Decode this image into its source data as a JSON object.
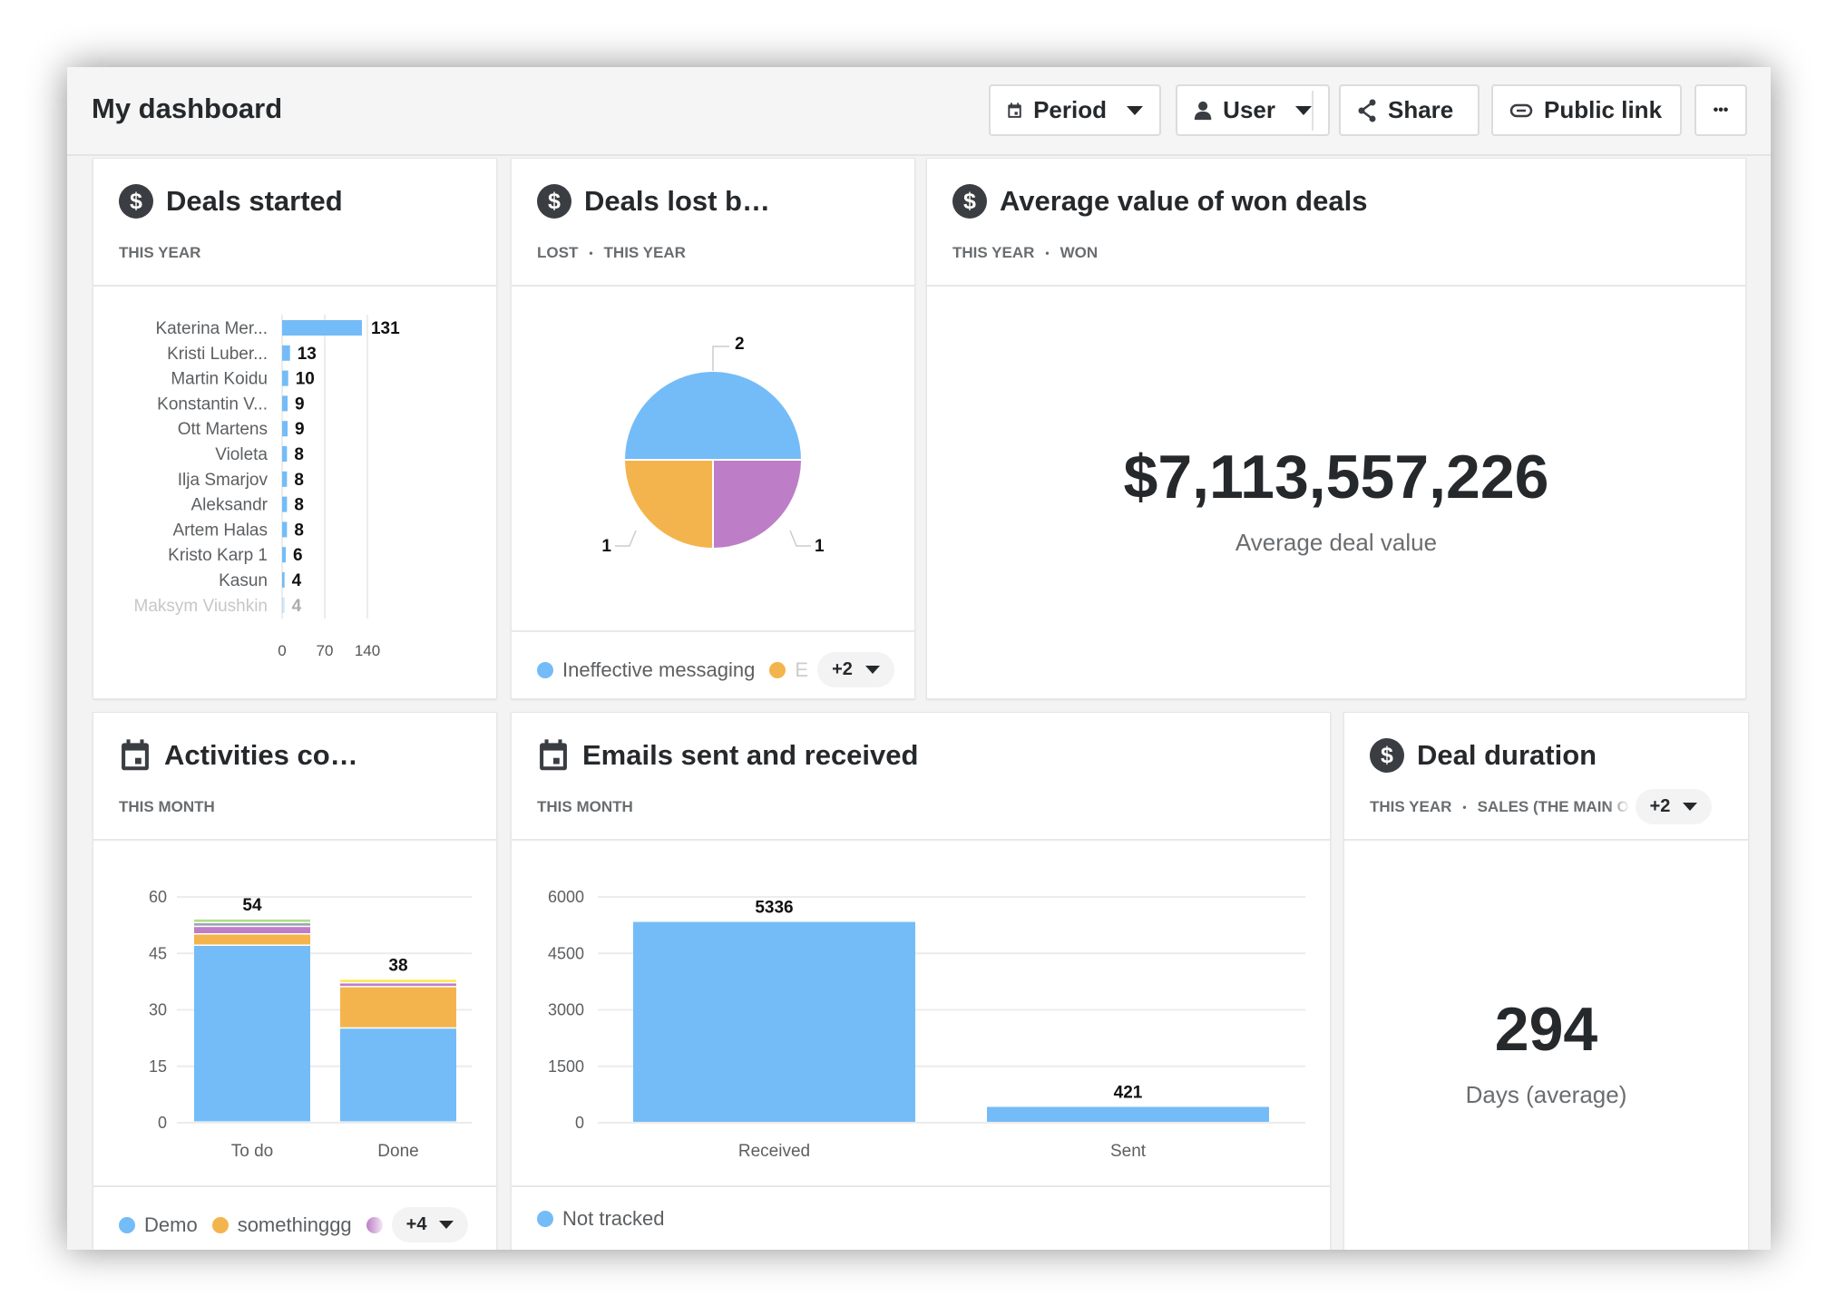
{
  "header": {
    "title": "My dashboard",
    "period_label": "Period",
    "user_label": "User",
    "share_label": "Share",
    "public_link_label": "Public link",
    "more_label": "•••"
  },
  "colors": {
    "blue": "#74bcf7",
    "orange": "#f4b44d",
    "purple": "#bd7dc7",
    "gray": "#9aa7b3",
    "green": "#b0dd8b",
    "yellow": "#fde95a"
  },
  "cards": {
    "deals_started": {
      "title": "Deals started",
      "filters": [
        "THIS YEAR"
      ],
      "icon": "dollar-icon"
    },
    "deals_lost": {
      "title": "Deals lost b…",
      "filters": [
        "LOST",
        "THIS YEAR"
      ],
      "icon": "dollar-icon",
      "legend": [
        {
          "label": "Ineffective messaging",
          "color": "#74bcf7"
        },
        {
          "label": "E",
          "color": "#f4b44d"
        }
      ],
      "more": "+2"
    },
    "avg_value": {
      "title": "Average value of won deals",
      "filters": [
        "THIS YEAR",
        "WON"
      ],
      "icon": "dollar-icon",
      "value": "$7,113,557,226",
      "caption": "Average deal value"
    },
    "activities": {
      "title": "Activities co…",
      "filters": [
        "THIS MONTH"
      ],
      "icon": "calendar-icon",
      "legend": [
        {
          "label": "Demo",
          "color": "#74bcf7"
        },
        {
          "label": "somethinggg",
          "color": "#f4b44d"
        },
        {
          "label": "",
          "color": "#bd7dc7"
        }
      ],
      "more": "+4"
    },
    "emails": {
      "title": "Emails sent and received",
      "filters": [
        "THIS MONTH"
      ],
      "icon": "calendar-icon",
      "legend": [
        {
          "label": "Not tracked",
          "color": "#74bcf7"
        }
      ]
    },
    "duration": {
      "title": "Deal duration",
      "filters": [
        "THIS YEAR",
        "SALES (THE MAIN O"
      ],
      "icon": "dollar-icon",
      "more": "+2",
      "value": "294",
      "caption": "Days (average)"
    }
  },
  "chart_data": [
    {
      "type": "bar",
      "orientation": "horizontal",
      "categories": [
        "Katerina Mer...",
        "Kristi Luber...",
        "Martin Koidu",
        "Konstantin V...",
        "Ott Martens",
        "Violeta",
        "Ilja Smarjov",
        "Aleksandr",
        "Artem Halas",
        "Kristo Karp 1",
        "Kasun",
        "Maksym Viushkin"
      ],
      "values": [
        131,
        13,
        10,
        9,
        9,
        8,
        8,
        8,
        8,
        6,
        4,
        4
      ],
      "xlim": [
        0,
        140
      ],
      "xticks": [
        "0",
        "70",
        "140"
      ],
      "grid": true
    },
    {
      "type": "pie",
      "values": [
        2,
        1,
        1
      ],
      "colors": [
        "#74bcf7",
        "#bd7dc7",
        "#f4b44d"
      ],
      "labels": [
        "2",
        "1",
        "1"
      ]
    },
    {
      "type": "bar",
      "stacked": true,
      "categories": [
        "To do",
        "Done"
      ],
      "totals": [
        "54",
        "38"
      ],
      "series": [
        {
          "name": "Demo",
          "color": "#74bcf7",
          "values": [
            47,
            25
          ]
        },
        {
          "name": "somethinggg",
          "color": "#f4b44d",
          "values": [
            3,
            11
          ]
        },
        {
          "color": "#bd7dc7",
          "values": [
            2,
            1
          ]
        },
        {
          "color": "#9aa7b3",
          "values": [
            1,
            0
          ]
        },
        {
          "color": "#b0dd8b",
          "values": [
            1,
            0
          ]
        },
        {
          "color": "#fde95a",
          "values": [
            0,
            1
          ]
        }
      ],
      "ylim": [
        0,
        60
      ],
      "yticks": [
        "0",
        "15",
        "30",
        "45",
        "60"
      ],
      "grid": true
    },
    {
      "type": "bar",
      "categories": [
        "Received",
        "Sent"
      ],
      "values": [
        5336,
        421
      ],
      "labels": [
        "5336",
        "421"
      ],
      "ylim": [
        0,
        6000
      ],
      "yticks": [
        "0",
        "1500",
        "3000",
        "4500",
        "6000"
      ],
      "grid": true,
      "series": [
        {
          "name": "Not tracked",
          "color": "#74bcf7"
        }
      ]
    }
  ]
}
